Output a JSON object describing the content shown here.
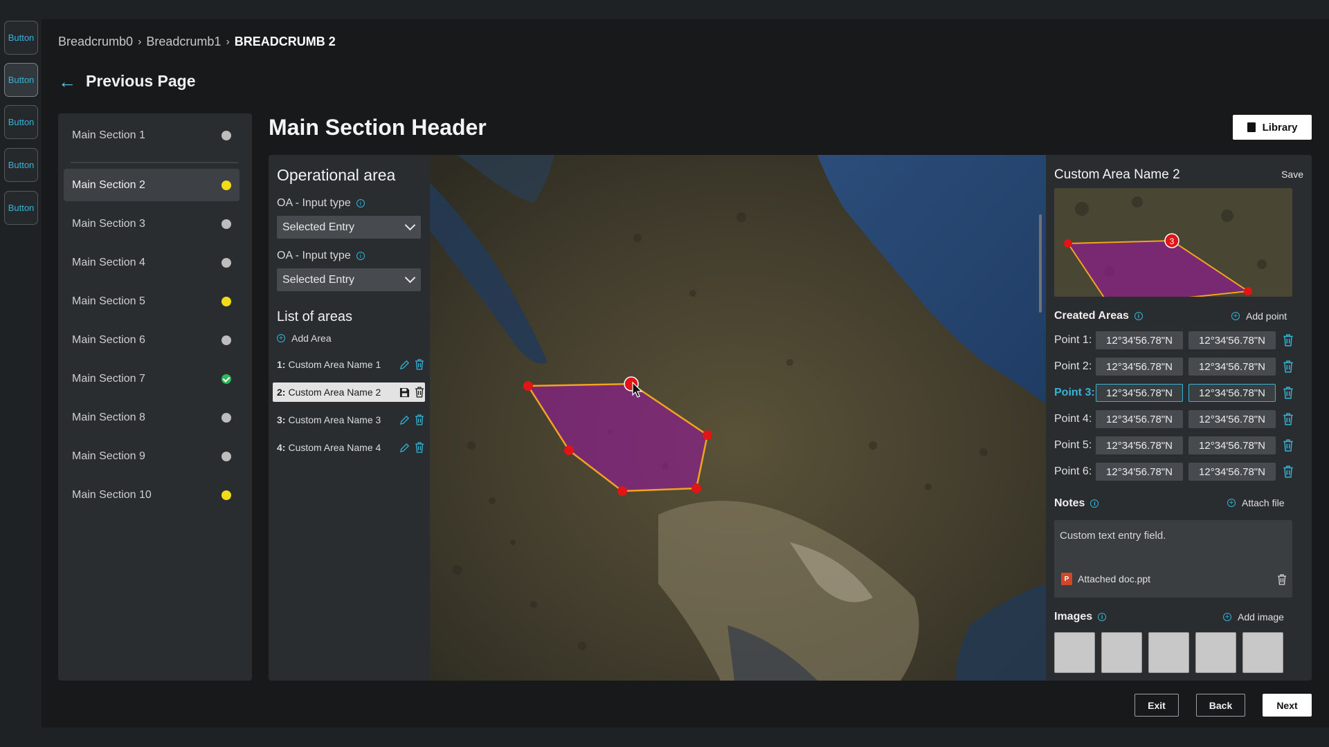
{
  "rail": {
    "buttons": [
      "Button",
      "Button",
      "Button",
      "Button",
      "Button"
    ]
  },
  "breadcrumb": {
    "items": [
      "Breadcrumb0",
      "Breadcrumb1"
    ],
    "current": "BREADCRUMB 2"
  },
  "nav": {
    "previous_label": "Previous Page"
  },
  "sidebar": {
    "items": [
      {
        "label": "Main Section 1",
        "status": "gray"
      },
      {
        "label": "Main Section 2",
        "status": "yellow"
      },
      {
        "label": "Main Section 3",
        "status": "gray"
      },
      {
        "label": "Main Section 4",
        "status": "gray"
      },
      {
        "label": "Main Section 5",
        "status": "yellow"
      },
      {
        "label": "Main Section 6",
        "status": "gray"
      },
      {
        "label": "Main Section 7",
        "status": "complete"
      },
      {
        "label": "Main Section 8",
        "status": "gray"
      },
      {
        "label": "Main Section 9",
        "status": "gray"
      },
      {
        "label": "Main Section 10",
        "status": "yellow"
      }
    ],
    "selected_index": 1
  },
  "main": {
    "header": "Main Section Header",
    "library_label": "Library"
  },
  "operational_area": {
    "title": "Operational area",
    "inputs": [
      {
        "label": "OA - Input type",
        "value": "Selected Entry"
      },
      {
        "label": "OA - Input type",
        "value": "Selected Entry"
      }
    ],
    "list_title": "List of areas",
    "add_area_label": "Add Area",
    "areas": [
      {
        "num": "1:",
        "name": "Custom Area Name 1"
      },
      {
        "num": "2:",
        "name": "Custom Area Name 2"
      },
      {
        "num": "3:",
        "name": "Custom Area Name 3"
      },
      {
        "num": "4:",
        "name": "Custom Area Name 4"
      }
    ],
    "selected_area_index": 1
  },
  "detail": {
    "title": "Custom Area Name 2",
    "save_label": "Save",
    "thumb_marker": "3",
    "created_areas_label": "Created Areas",
    "add_point_label": "Add point",
    "points": [
      {
        "label": "Point 1:",
        "lat": "12°34'56.78\"N",
        "lon": "12°34'56.78\"N"
      },
      {
        "label": "Point 2:",
        "lat": "12°34'56.78\"N",
        "lon": "12°34'56.78\"N"
      },
      {
        "label": "Point 3:",
        "lat": "12°34'56.78\"N",
        "lon": "12°34'56.78\"N"
      },
      {
        "label": "Point 4:",
        "lat": "12°34'56.78\"N",
        "lon": "12°34'56.78\"N"
      },
      {
        "label": "Point 5:",
        "lat": "12°34'56.78\"N",
        "lon": "12°34'56.78\"N"
      },
      {
        "label": "Point 6:",
        "lat": "12°34'56.78\"N",
        "lon": "12°34'56.78\"N"
      }
    ],
    "active_point_index": 2,
    "notes_label": "Notes",
    "attach_file_label": "Attach file",
    "notes_text": "Custom text entry field.",
    "attachment_name": "Attached doc.ppt",
    "images_label": "Images",
    "add_image_label": "Add image"
  },
  "footer": {
    "exit_label": "Exit",
    "back_label": "Back",
    "next_label": "Next"
  },
  "colors": {
    "accent": "#35b4d8",
    "status_yellow": "#f2dc1a",
    "status_complete": "#2fb75a",
    "polygon_fill": "#8a1f8a",
    "polygon_stroke": "#f2a41e",
    "vertex": "#e01515"
  }
}
